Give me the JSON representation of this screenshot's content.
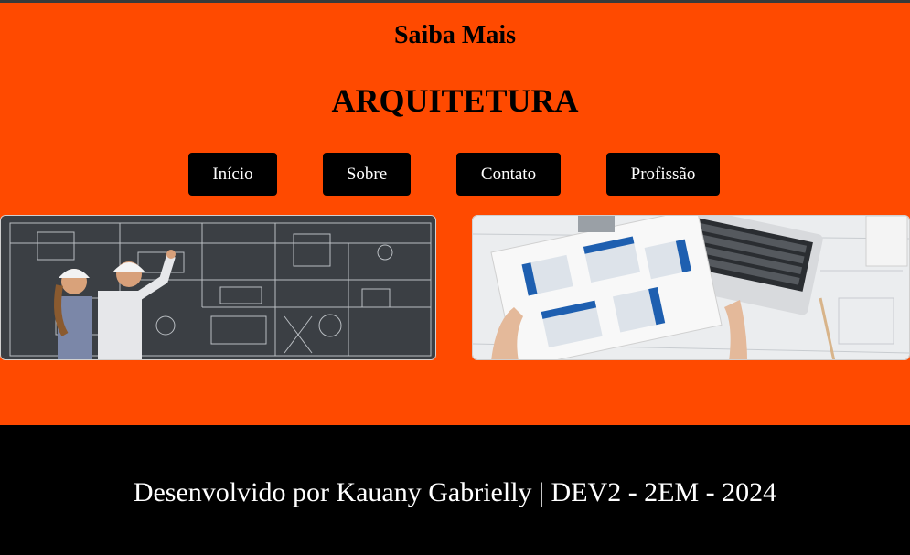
{
  "header": {
    "pretitle": "Saiba Mais",
    "title": "ARQUITETURA"
  },
  "nav": {
    "items": [
      {
        "label": "Início"
      },
      {
        "label": "Sobre"
      },
      {
        "label": "Contato"
      },
      {
        "label": "Profissão"
      }
    ]
  },
  "footer": {
    "text": "Desenvolvido por Kauany Gabrielly | DEV2 - 2EM - 2024"
  },
  "colors": {
    "background": "#ff4a00",
    "nav_button": "#000000",
    "footer": "#000000"
  }
}
